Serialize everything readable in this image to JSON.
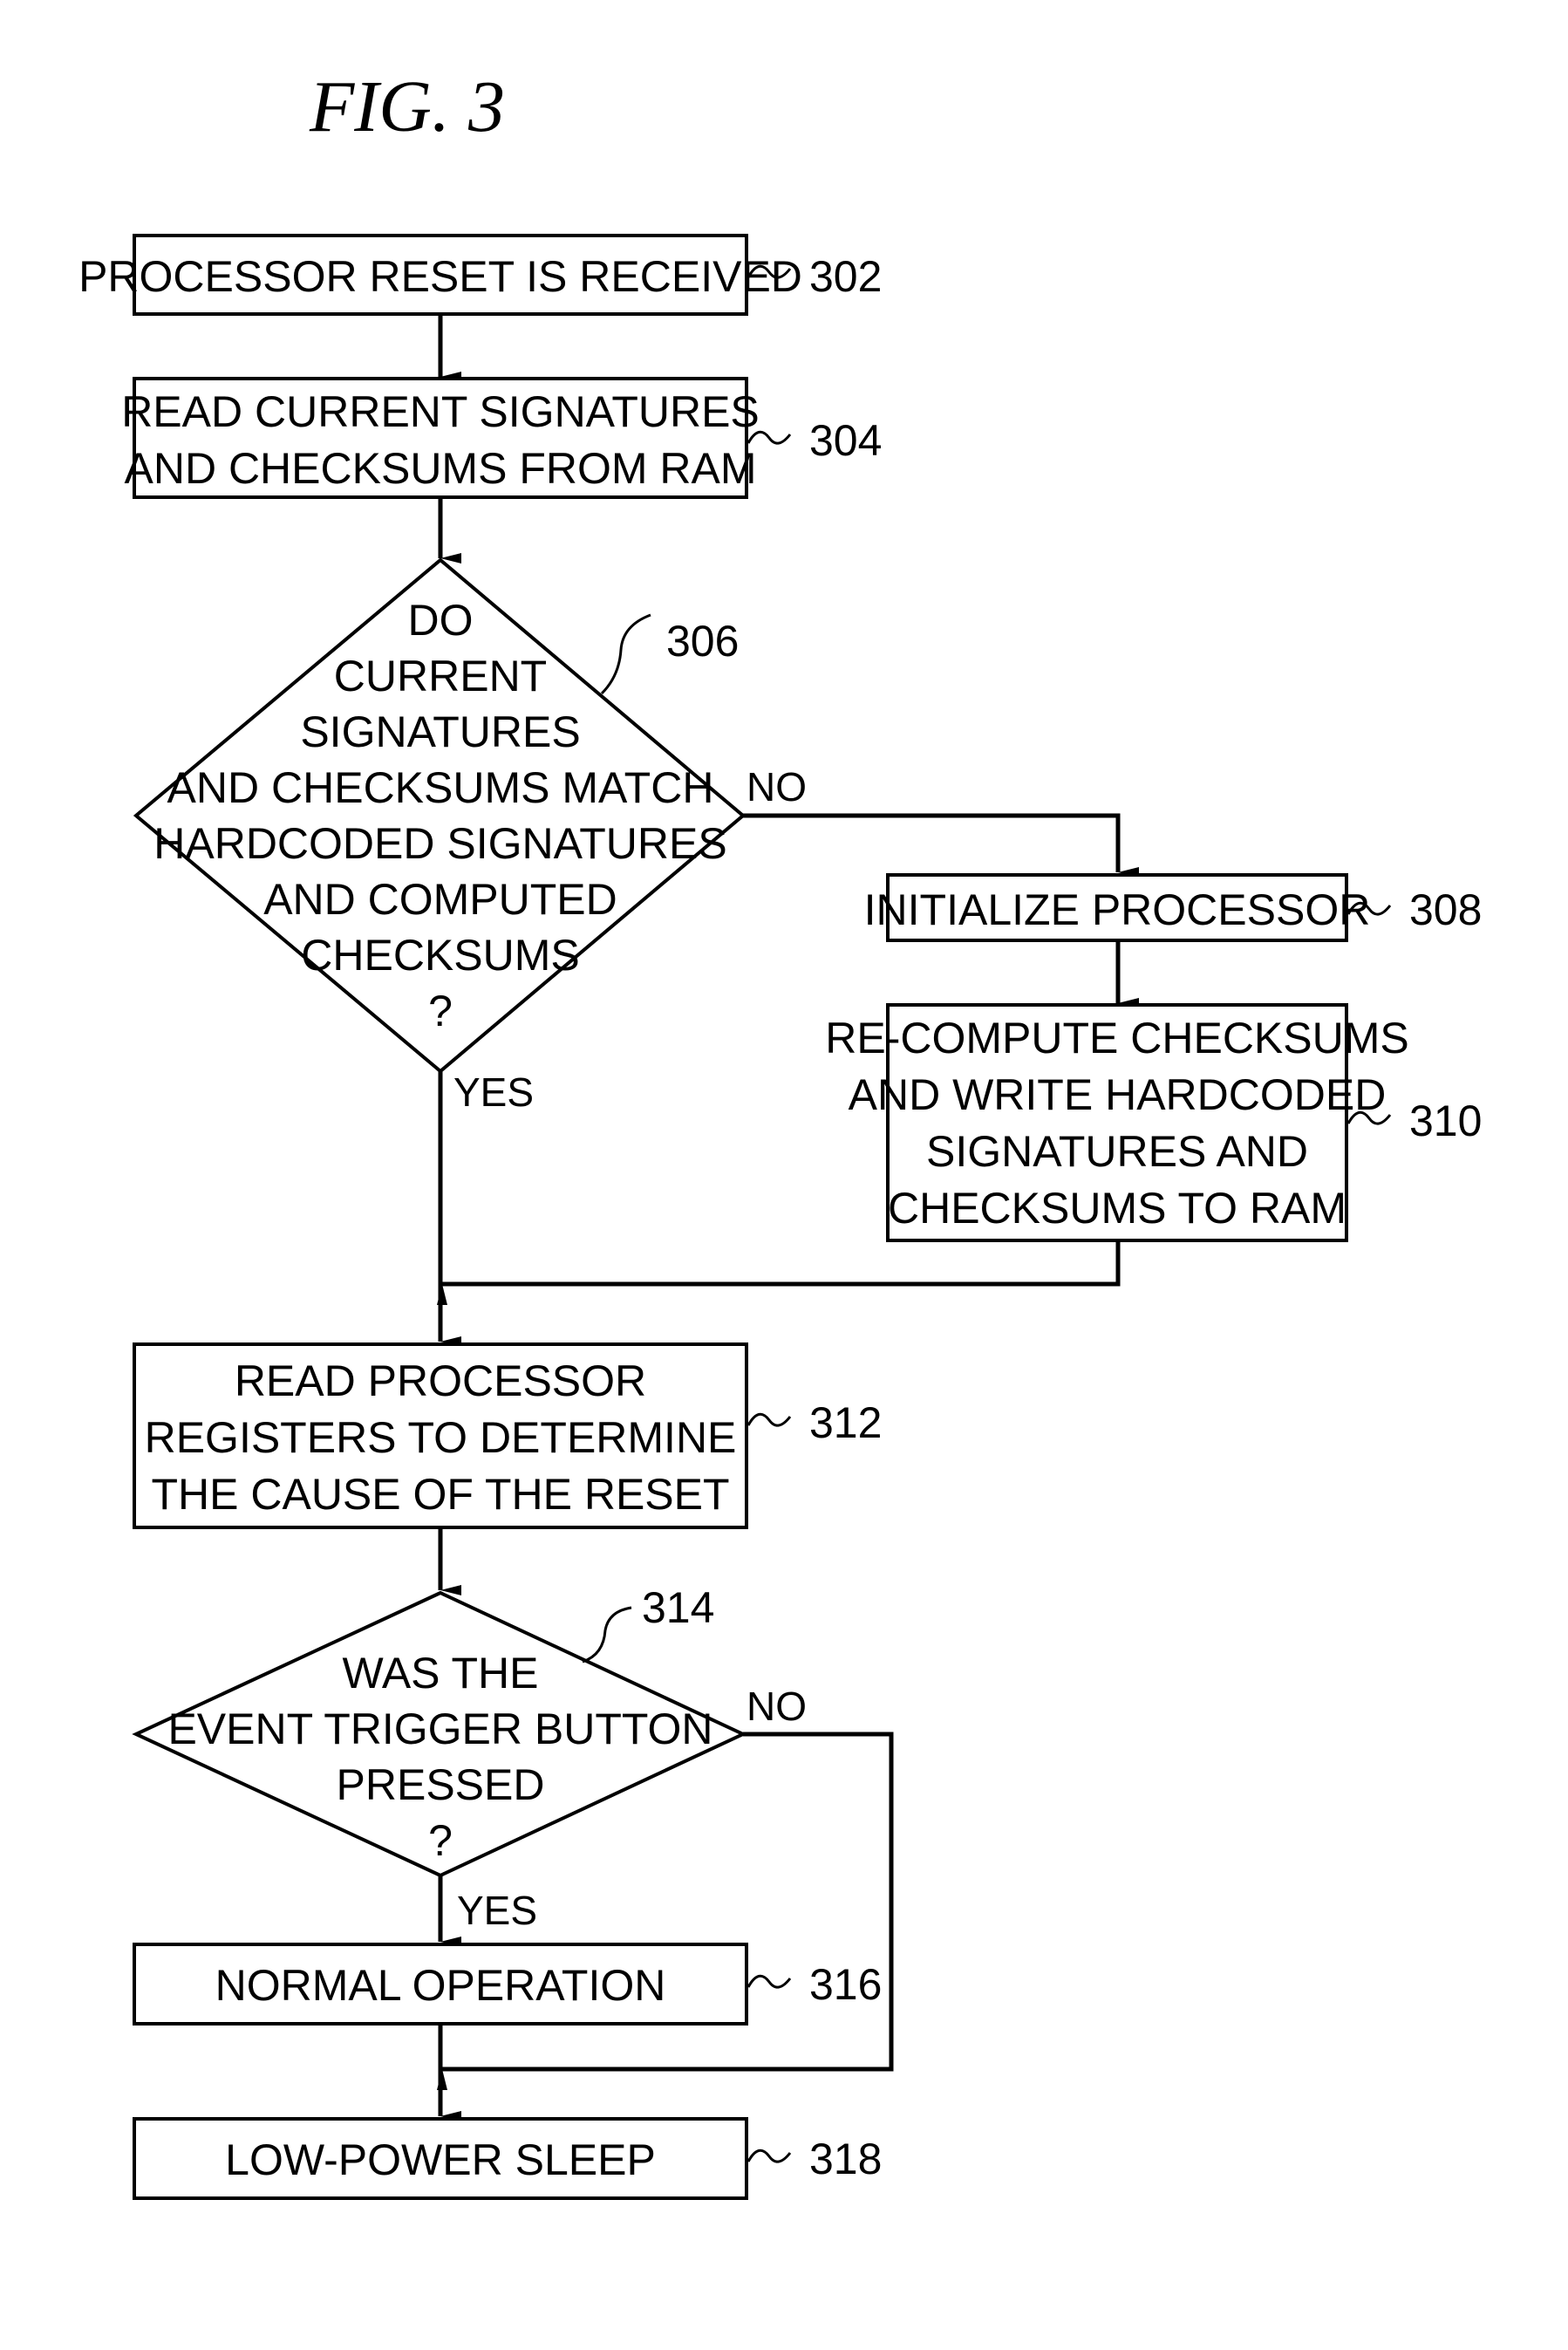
{
  "figure": {
    "title": "FIG.  3"
  },
  "nodes": {
    "n302": {
      "ref": "302",
      "lines": [
        "PROCESSOR RESET IS RECEIVED"
      ]
    },
    "n304": {
      "ref": "304",
      "lines": [
        "READ CURRENT SIGNATURES",
        "AND CHECKSUMS FROM RAM"
      ]
    },
    "n306": {
      "ref": "306",
      "lines": [
        "DO",
        "CURRENT",
        "SIGNATURES",
        "AND CHECKSUMS MATCH",
        "HARDCODED SIGNATURES",
        "AND COMPUTED",
        "CHECKSUMS",
        "?"
      ]
    },
    "n308": {
      "ref": "308",
      "lines": [
        "INITIALIZE PROCESSOR"
      ]
    },
    "n310": {
      "ref": "310",
      "lines": [
        "RE-COMPUTE CHECKSUMS",
        "AND WRITE HARDCODED",
        "SIGNATURES AND",
        "CHECKSUMS TO RAM"
      ]
    },
    "n312": {
      "ref": "312",
      "lines": [
        "READ PROCESSOR",
        "REGISTERS TO DETERMINE",
        "THE CAUSE OF THE RESET"
      ]
    },
    "n314": {
      "ref": "314",
      "lines": [
        "WAS THE",
        "EVENT TRIGGER BUTTON",
        "PRESSED",
        "?"
      ]
    },
    "n316": {
      "ref": "316",
      "lines": [
        "NORMAL OPERATION"
      ]
    },
    "n318": {
      "ref": "318",
      "lines": [
        "LOW-POWER SLEEP"
      ]
    }
  },
  "edges": {
    "no_306": "NO",
    "yes_306": "YES",
    "no_314": "NO",
    "yes_314": "YES"
  }
}
